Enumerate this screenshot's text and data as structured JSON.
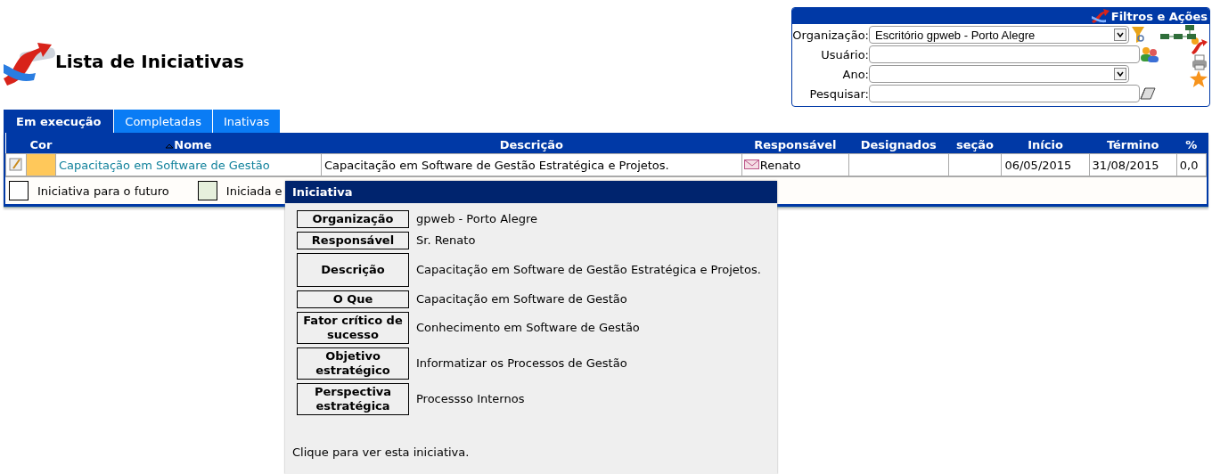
{
  "page": {
    "title": "Lista de Iniciativas"
  },
  "filters": {
    "title": "Filtros e Ações",
    "fields": [
      {
        "label": "Organização:",
        "kind": "select",
        "value": "Escritório gpweb - Porto Alegre"
      },
      {
        "label": "Usuário:",
        "kind": "text"
      },
      {
        "label": "Ano:",
        "kind": "select"
      },
      {
        "label": "Pesquisar:",
        "kind": "text"
      }
    ]
  },
  "tabs": [
    {
      "label": "Em execução",
      "selected": true
    },
    {
      "label": "Completadas",
      "selected": false
    },
    {
      "label": "Inativas",
      "selected": false
    }
  ],
  "table": {
    "columns": [
      "Cor",
      "Nome",
      "Descrição",
      "Responsável",
      "Designados",
      "seção",
      "Início",
      "Término",
      "%"
    ],
    "rows": [
      {
        "color": "#ffc85a",
        "name": "Capacitação em Software de Gestão",
        "description": "Capacitação em Software de Gestão Estratégica e Projetos.",
        "responsible": "Renato",
        "start": "06/05/2015",
        "end": "31/08/2015",
        "percent": "0,0"
      }
    ]
  },
  "legend": [
    {
      "label": "Iniciativa para o futuro",
      "color": "#ffffff"
    },
    {
      "label": "Iniciada e",
      "color": "#e6f0dc"
    }
  ],
  "tooltip": {
    "title": "Iniciativa",
    "fields": [
      {
        "label": "Organização",
        "value": "gpweb - Porto Alegre"
      },
      {
        "label": "Responsável",
        "value": "Sr. Renato"
      },
      {
        "label": "Descrição",
        "value": "Capacitação em Software de Gestão Estratégica e Projetos."
      },
      {
        "label": "O Que",
        "value": "Capacitação em Software de Gestão"
      },
      {
        "label": "Fator crítico de sucesso",
        "value": "Conhecimento em Software de Gestão"
      },
      {
        "label": "Objetivo estratégico",
        "value": "Informatizar os Processos de Gestão"
      },
      {
        "label": "Perspectiva estratégica",
        "value": "Processso Internos"
      }
    ],
    "footer": "Clique para ver esta iniciativa."
  }
}
